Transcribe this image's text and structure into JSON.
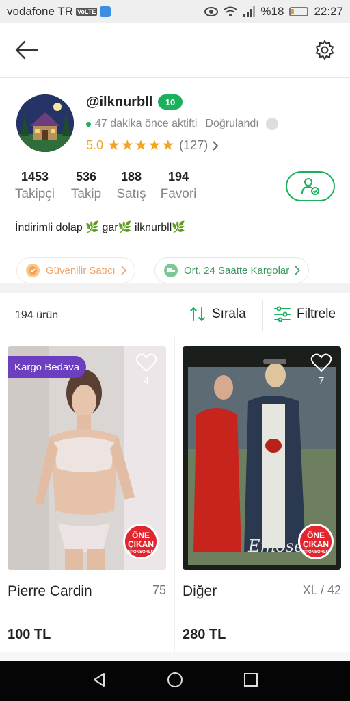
{
  "status_bar": {
    "carrier": "vodafone TR",
    "volte": "VoLTE",
    "battery": "%18",
    "time": "22:27",
    "battery_level": 0.18
  },
  "profile": {
    "username": "@ilknurbll",
    "level": "10",
    "active_text": "47 dakika önce aktifti",
    "verified": "Doğrulandı",
    "rating": "5.0",
    "stars": "★★★★★",
    "rating_count": "(127)",
    "stats": [
      {
        "value": "1453",
        "label": "Takipçi"
      },
      {
        "value": "536",
        "label": "Takip"
      },
      {
        "value": "188",
        "label": "Satış"
      },
      {
        "value": "194",
        "label": "Favori"
      }
    ],
    "bio": "İndirimli dolap 🌿 gar🌿 ilknurbll🌿"
  },
  "badges": {
    "trusted": "Güvenilir Satıcı",
    "shipping": "Ort. 24 Saatte Kargolar"
  },
  "toolbar": {
    "count": "194 ürün",
    "sort": "Sırala",
    "filter": "Filtrele"
  },
  "products": [
    {
      "badge": "Kargo Bedava",
      "likes": "4",
      "brand": "Pierre Cardin",
      "size": "75",
      "price": "100 TL",
      "sponsor_top": "ÖNE",
      "sponsor_mid": "ÇIKAN",
      "sponsor_sub": "SPONSORLU"
    },
    {
      "badge": "",
      "likes": "7",
      "brand": "Diğer",
      "size": "XL / 42",
      "price": "280 TL",
      "sponsor_top": "ÖNE",
      "sponsor_mid": "ÇIKAN",
      "sponsor_sub": "SPONSORLU"
    }
  ],
  "colors": {
    "accent_green": "#1ab05c",
    "star": "#f2a423",
    "kargo_purple": "#6b3fbf"
  }
}
